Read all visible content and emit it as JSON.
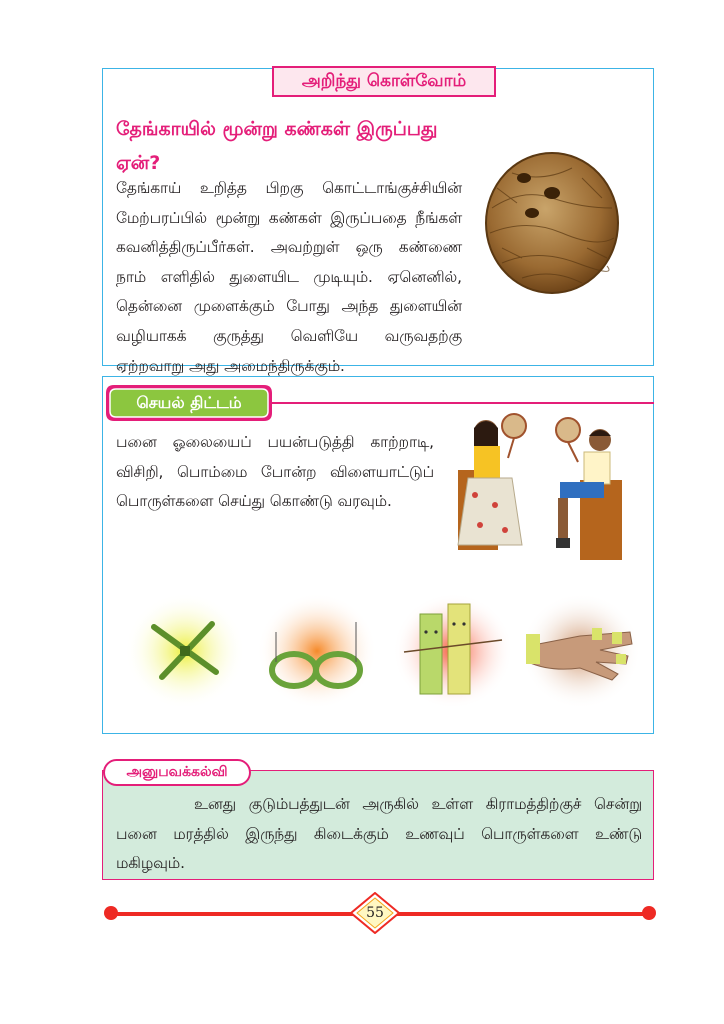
{
  "box1": {
    "title": "அறிந்து கொள்வோம்",
    "question": "தேங்காயில் மூன்று கண்கள் இருப்பது ஏன்?",
    "paragraph": "தேங்காய் உறித்த பிறகு கொட்டாங்குச்சியின் மேற்பரப்பில் மூன்று கண்கள் இருப்பதை நீங்கள் கவனித்திருப்பீர்கள். அவற்றுள் ஒரு கண்ணை நாம் எளிதில் துளையிட முடியும். ஏனெனில், தென்னை முளைக்கும் போது அந்த துளையின் வழியாகக் குருத்து வெளியே வருவதற்கு ஏற்றவாறு அது அமைந்திருக்கும்."
  },
  "box2": {
    "title": "செயல் திட்டம்",
    "paragraph": "பனை ஓலையைப் பயன்படுத்தி காற்றாடி, விசிறி, பொம்மை போன்ற விளையாட்டுப் பொருள்களை செய்து கொண்டு வரவும்."
  },
  "box3": {
    "title": "அனுபவக்கல்வி",
    "paragraph": "உனது குடும்பத்துடன் அருகில் உள்ள கிராமத்திற்குச் சென்று பனை மரத்தில் இருந்து கிடைக்கும் உணவுப் பொருள்களை உண்டு மகிழவும்."
  },
  "footer": {
    "page_number": "55"
  },
  "colors": {
    "frame_blue": "#3cb4e6",
    "magenta": "#e41e79",
    "title_fill": "#fde7ee",
    "experience_fill": "#d3ebdc",
    "footer_red": "#ee2a24",
    "tag_green": "#8cc63f"
  }
}
